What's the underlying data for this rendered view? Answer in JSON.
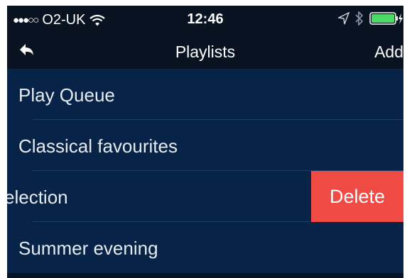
{
  "status_bar": {
    "signal": "●●●○○",
    "carrier": "O2-UK",
    "time": "12:46"
  },
  "nav": {
    "back_icon": "back-arrow-icon",
    "title": "Playlists",
    "add_label": "Add"
  },
  "playlists": [
    {
      "name": "Play Queue"
    },
    {
      "name": "Classical favourites"
    },
    {
      "name": "election"
    },
    {
      "name": "Summer evening"
    }
  ],
  "delete_label": "Delete",
  "colors": {
    "background": "#072348",
    "header": "#081220",
    "delete": "#f04a45",
    "battery": "#4cd964"
  }
}
